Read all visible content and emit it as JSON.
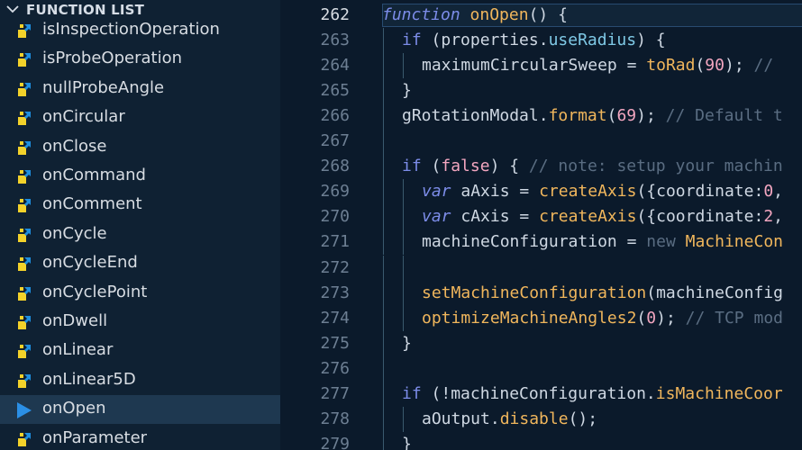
{
  "sidebar": {
    "title": "FUNCTION LIST",
    "items": [
      {
        "label": "isInspectionOperation",
        "selected": false
      },
      {
        "label": "isProbeOperation",
        "selected": false
      },
      {
        "label": "nullProbeAngle",
        "selected": false
      },
      {
        "label": "onCircular",
        "selected": false
      },
      {
        "label": "onClose",
        "selected": false
      },
      {
        "label": "onCommand",
        "selected": false
      },
      {
        "label": "onComment",
        "selected": false
      },
      {
        "label": "onCycle",
        "selected": false
      },
      {
        "label": "onCycleEnd",
        "selected": false
      },
      {
        "label": "onCyclePoint",
        "selected": false
      },
      {
        "label": "onDwell",
        "selected": false
      },
      {
        "label": "onLinear",
        "selected": false
      },
      {
        "label": "onLinear5D",
        "selected": false
      },
      {
        "label": "onOpen",
        "selected": true
      },
      {
        "label": "onParameter",
        "selected": false
      }
    ]
  },
  "editor": {
    "current_line": "262",
    "lines": [
      {
        "num": "262",
        "tokens": [
          [
            "kwi",
            "function"
          ],
          [
            "pun",
            " "
          ],
          [
            "fn",
            "onOpen"
          ],
          [
            "pun",
            "() {"
          ]
        ]
      },
      {
        "num": "263",
        "tokens": [
          [
            "kw",
            "if"
          ],
          [
            "pun",
            " (properties."
          ],
          [
            "prop",
            "useRadius"
          ],
          [
            "pun",
            ") {"
          ]
        ]
      },
      {
        "num": "264",
        "tokens": [
          [
            "var",
            "maximumCircularSweep"
          ],
          [
            "pun",
            " = "
          ],
          [
            "fn",
            "toRad"
          ],
          [
            "pun",
            "("
          ],
          [
            "num",
            "90"
          ],
          [
            "pun",
            "); "
          ],
          [
            "com",
            "//"
          ]
        ]
      },
      {
        "num": "265",
        "tokens": [
          [
            "pun",
            "}"
          ]
        ]
      },
      {
        "num": "266",
        "tokens": [
          [
            "var",
            "gRotationModal"
          ],
          [
            "pun",
            "."
          ],
          [
            "fn",
            "format"
          ],
          [
            "pun",
            "("
          ],
          [
            "num",
            "69"
          ],
          [
            "pun",
            "); "
          ],
          [
            "com",
            "// Default t"
          ]
        ]
      },
      {
        "num": "267",
        "tokens": []
      },
      {
        "num": "268",
        "tokens": [
          [
            "kw",
            "if"
          ],
          [
            "pun",
            " ("
          ],
          [
            "num",
            "false"
          ],
          [
            "pun",
            ") { "
          ],
          [
            "com",
            "// note: setup your machin"
          ]
        ]
      },
      {
        "num": "269",
        "tokens": [
          [
            "kwi",
            "var"
          ],
          [
            "pun",
            " aAxis = "
          ],
          [
            "fn",
            "createAxis"
          ],
          [
            "pun",
            "({coordinate:"
          ],
          [
            "num",
            "0"
          ],
          [
            "pun",
            ","
          ]
        ]
      },
      {
        "num": "270",
        "tokens": [
          [
            "kwi",
            "var"
          ],
          [
            "pun",
            " cAxis = "
          ],
          [
            "fn",
            "createAxis"
          ],
          [
            "pun",
            "({coordinate:"
          ],
          [
            "num",
            "2"
          ],
          [
            "pun",
            ","
          ]
        ]
      },
      {
        "num": "271",
        "tokens": [
          [
            "var",
            "machineConfiguration"
          ],
          [
            "pun",
            " = "
          ],
          [
            "new",
            "new"
          ],
          [
            "pun",
            " "
          ],
          [
            "cls",
            "MachineCon"
          ]
        ]
      },
      {
        "num": "272",
        "tokens": []
      },
      {
        "num": "273",
        "tokens": [
          [
            "fn",
            "setMachineConfiguration"
          ],
          [
            "pun",
            "(machineConfig"
          ]
        ]
      },
      {
        "num": "274",
        "tokens": [
          [
            "fn",
            "optimizeMachineAngles2"
          ],
          [
            "pun",
            "("
          ],
          [
            "num",
            "0"
          ],
          [
            "pun",
            "); "
          ],
          [
            "com",
            "// TCP mod"
          ]
        ]
      },
      {
        "num": "275",
        "tokens": [
          [
            "pun",
            "}"
          ]
        ]
      },
      {
        "num": "276",
        "tokens": []
      },
      {
        "num": "277",
        "tokens": [
          [
            "kw",
            "if"
          ],
          [
            "pun",
            " (!machineConfiguration."
          ],
          [
            "fn",
            "isMachineCoor"
          ]
        ]
      },
      {
        "num": "278",
        "tokens": [
          [
            "var",
            "aOutput"
          ],
          [
            "pun",
            "."
          ],
          [
            "fn",
            "disable"
          ],
          [
            "pun",
            "();"
          ]
        ]
      },
      {
        "num": "279",
        "tokens": [
          [
            "pun",
            "}"
          ]
        ]
      }
    ]
  },
  "colors": {
    "background": "#0b1a2b",
    "sidebar_bg": "#0f2133",
    "selection_bg": "#1e3850",
    "icon_yellow": "#f3d22a",
    "icon_blue": "#1e8fe0",
    "selected_arrow": "#2b8fe5"
  },
  "icons": {
    "header": "chevron-down-icon",
    "function": "function-symbol-icon",
    "selected": "play-arrow-icon"
  }
}
